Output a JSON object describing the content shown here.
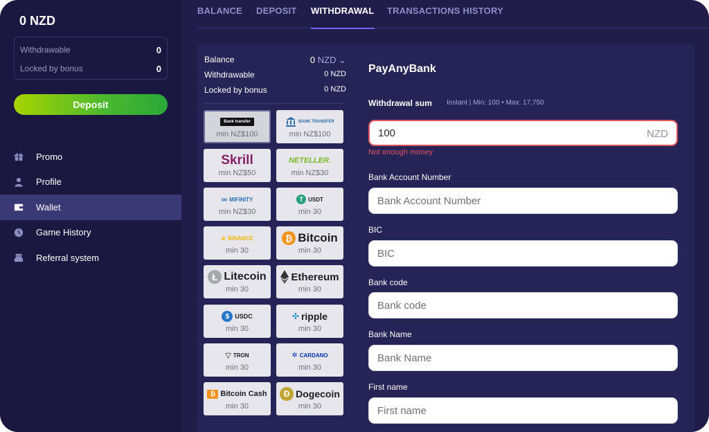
{
  "sidebar": {
    "balance_title": "0 NZD",
    "withdrawable_label": "Withdrawable",
    "withdrawable_value": "0",
    "locked_label": "Locked by bonus",
    "locked_value": "0",
    "deposit_label": "Deposit",
    "nav": [
      {
        "label": "Promo",
        "icon": "gift-icon"
      },
      {
        "label": "Profile",
        "icon": "user-icon"
      },
      {
        "label": "Wallet",
        "icon": "wallet-icon",
        "active": true
      },
      {
        "label": "Game History",
        "icon": "clock-icon"
      },
      {
        "label": "Referral system",
        "icon": "referral-icon"
      }
    ]
  },
  "tabs": [
    {
      "label": "BALANCE"
    },
    {
      "label": "DEPOSIT"
    },
    {
      "label": "WITHDRAWAL",
      "active": true
    },
    {
      "label": "TRANSACTIONS HISTORY"
    }
  ],
  "summary": {
    "balance_label": "Balance",
    "balance_value": "0",
    "balance_unit": "NZD ⌄",
    "withdrawable_label": "Withdrawable",
    "withdrawable_value": "0 NZD",
    "locked_label": "Locked by bonus",
    "locked_value": "0 NZD"
  },
  "methods": [
    {
      "name": "bank-transfer",
      "logo": "Bank transfer",
      "min": "min NZ$100",
      "selected": true
    },
    {
      "name": "bank-transfer-2",
      "logo": "BANK TRANSFER",
      "min": "min NZ$100"
    },
    {
      "name": "skrill",
      "logo": "Skrill",
      "min": "min NZ$50"
    },
    {
      "name": "neteller",
      "logo": "NETELLER.",
      "min": "min NZ$30"
    },
    {
      "name": "mifinity",
      "logo": "MIFINITY",
      "min": "min NZ$30"
    },
    {
      "name": "usdt",
      "logo": "USDT",
      "min": "min 30"
    },
    {
      "name": "binance",
      "logo": "BINANCE",
      "min": "min 30"
    },
    {
      "name": "bitcoin",
      "logo": "Bitcoin",
      "min": "min 30"
    },
    {
      "name": "litecoin",
      "logo": "Litecoin",
      "min": "min 30"
    },
    {
      "name": "ethereum",
      "logo": "Ethereum",
      "min": "min 30"
    },
    {
      "name": "usdc",
      "logo": "USDC",
      "min": "min 30"
    },
    {
      "name": "ripple",
      "logo": "ripple",
      "min": "min 30"
    },
    {
      "name": "tron",
      "logo": "TRON",
      "min": "min 30"
    },
    {
      "name": "cardano",
      "logo": "CARDANO",
      "min": "min 30"
    },
    {
      "name": "bitcoin-cash",
      "logo": "Bitcoin Cash",
      "min": "min 30"
    },
    {
      "name": "dogecoin",
      "logo": "Dogecoin",
      "min": "min 30"
    }
  ],
  "form": {
    "title": "PayAnyBank",
    "withdrawal_sum_label": "Withdrawal sum",
    "withdrawal_sum_info": "Instant | Min: 100 • Max: 17,750",
    "amount_value": "100",
    "amount_currency": "NZD",
    "error_message": "Not enough money",
    "fields": [
      {
        "label": "Bank Account Number",
        "placeholder": "Bank Account Number"
      },
      {
        "label": "BIC",
        "placeholder": "BIC"
      },
      {
        "label": "Bank code",
        "placeholder": "Bank code"
      },
      {
        "label": "Bank Name",
        "placeholder": "Bank Name"
      },
      {
        "label": "First name",
        "placeholder": "First name"
      }
    ]
  },
  "colors": {
    "background": "#201d4a",
    "sidebar": "#1a1840",
    "panel": "#262356",
    "accent_tab": "#6b66ff",
    "deposit_green": "#4ab830",
    "error": "#e05560"
  }
}
